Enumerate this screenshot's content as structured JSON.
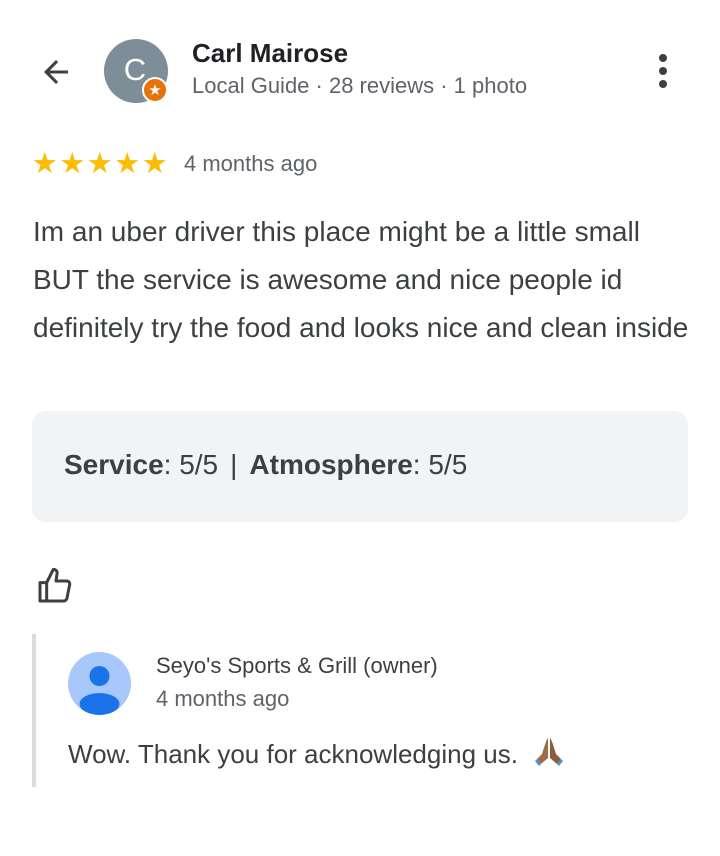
{
  "review": {
    "author": {
      "initial": "C",
      "name": "Carl Mairose",
      "meta": "Local Guide · 28 reviews · 1 photo",
      "avatar_color": "#7e8e99",
      "badge_color": "#e8710a"
    },
    "rating": 5,
    "star_color": "#fbbc04",
    "date": "4 months ago",
    "text": "Im an uber driver this place might be a little small BUT the service is awesome and nice people id definitely try the food and looks nice and clean inside",
    "attributes": [
      {
        "name": "Service",
        "value": ": 5/5"
      },
      {
        "name": "Atmosphere",
        "value": ": 5/5"
      }
    ],
    "attribute_separator": "|"
  },
  "owner_response": {
    "name": "Seyo's Sports & Grill (owner)",
    "date": "4 months ago",
    "text": "Wow. Thank you for acknowledging us.",
    "emoji_icon": "folded-hands-icon",
    "avatar_color": "#a8c7fa",
    "avatar_figure_color": "#1a73e8"
  },
  "icons": {
    "back": "back-arrow-icon",
    "more": "more-vert-icon",
    "like": "thumbs-up-icon",
    "badge": "local-guide-star-icon"
  }
}
